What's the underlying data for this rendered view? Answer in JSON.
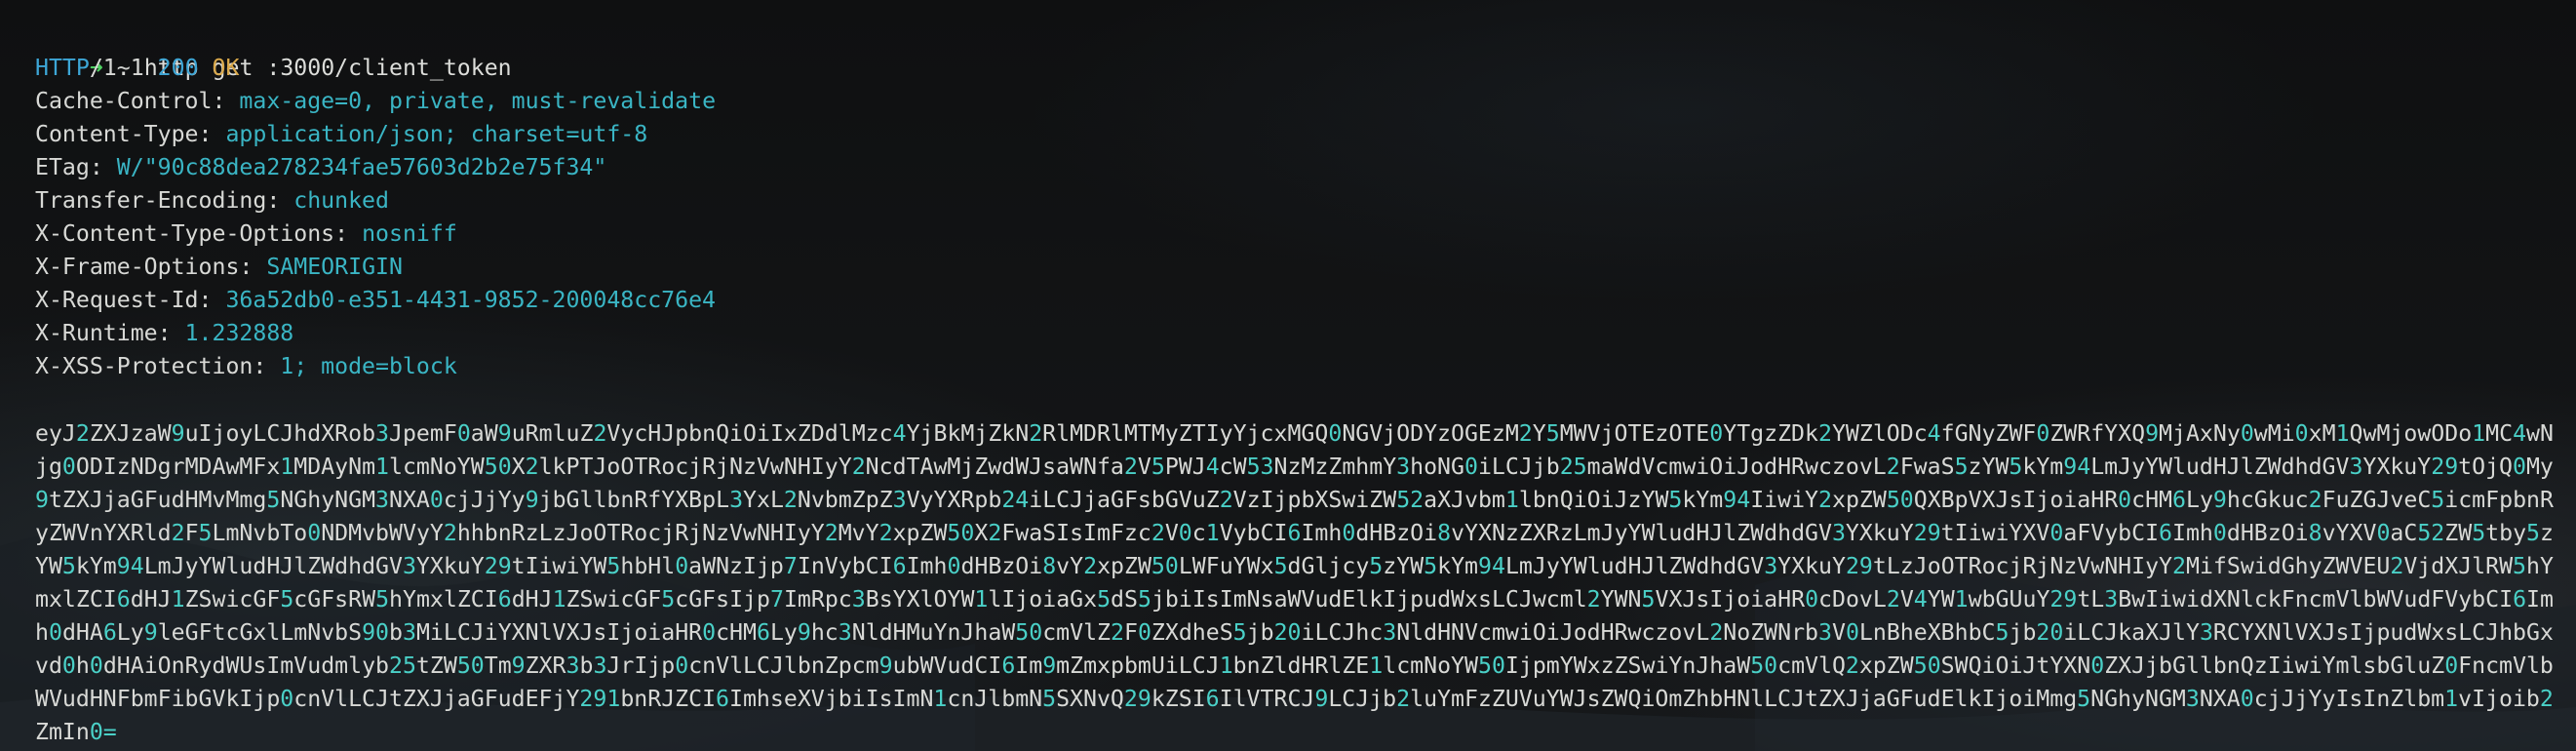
{
  "prompt": {
    "arrow": "➜",
    "cwd": "~",
    "command": "http get :3000/client_token"
  },
  "status": {
    "protocol": "HTTP",
    "version": "/1.1",
    "code": "200",
    "text": "OK"
  },
  "headers": [
    {
      "name": "Cache-Control:",
      "value": "max-age=0, private, must-revalidate"
    },
    {
      "name": "Content-Type:",
      "value": "application/json; charset=utf-8"
    },
    {
      "name": "ETag:",
      "value": "W/\"90c88dea278234fae57603d2b2e75f34\""
    },
    {
      "name": "Transfer-Encoding:",
      "value": "chunked"
    },
    {
      "name": "X-Content-Type-Options:",
      "value": "nosniff"
    },
    {
      "name": "X-Frame-Options:",
      "value": "SAMEORIGIN"
    },
    {
      "name": "X-Request-Id:",
      "value": "36a52db0-e351-4431-9852-200048cc76e4"
    },
    {
      "name": "X-Runtime:",
      "value": "1.232888"
    },
    {
      "name": "X-XSS-Protection:",
      "value": "1; mode=block"
    }
  ],
  "body": "eyJ2ZXJzaW9uIjoyLCJhdXRob3JpemF0aW9uRmluZ2VycHJpbnQiOiIxZDdlMzc4YjBkMjZkN2RlMDRlMTMyZTIyYjcxMGQ0NGVjODYzOGEzM2Y5MWVjOTEzOTE0YTgzZDk2YWZlODc4fGNyZWF0ZWRfYXQ9MjAxNy0wMi0xM1QwMjowODo1MC4wNjg0ODIzNDgrMDAwMFx1MDAyNm1lcmNoYW50X2lkPTJoOTRocjRjNzVwNHIyY2NcdTAwMjZwdWJsaWNfa2V5PWJ4cW53NzMzZmhmY3hoNG0iLCJjb25maWdVcmwiOiJodHRwczovL2FwaS5zYW5kYm94LmJyYWludHJlZWdhdGV3YXkuY29tOjQ0My9tZXJjaGFudHMvMmg5NGhyNGM3NXA0cjJjYy9jbGllbnRfYXBpL3YxL2NvbmZpZ3VyYXRpb24iLCJjaGFsbGVuZ2VzIjpbXSwiZW52aXJvbm1lbnQiOiJzYW5kYm94IiwiY2xpZW50QXBpVXJsIjoiaHR0cHM6Ly9hcGkuc2FuZGJveC5icmFpbnRyZWVnYXRld2F5LmNvbTo0NDMvbWVyY2hhbnRzLzJoOTRocjRjNzVwNHIyY2MvY2xpZW50X2FwaSIsImFzc2V0c1VybCI6Imh0dHBzOi8vYXNzZXRzLmJyYWludHJlZWdhdGV3YXkuY29tIiwiYXV0aFVybCI6Imh0dHBzOi8vYXV0aC52ZW5tby5zYW5kYm94LmJyYWludHJlZWdhdGV3YXkuY29tIiwiYW5hbHl0aWNzIjp7InVybCI6Imh0dHBzOi8vY2xpZW50LWFuYWx5dGljcy5zYW5kYm94LmJyYWludHJlZWdhdGV3YXkuY29tLzJoOTRocjRjNzVwNHIyY2MifSwidGhyZWVEU2VjdXJlRW5hYmxlZCI6dHJ1ZSwicGF5cGFsRW5hYmxlZCI6dHJ1ZSwicGF5cGFsIjp7ImRpc3BsYXlOYW1lIjoiaGx5dS5jbiIsImNsaWVudElkIjpudWxsLCJwcml2YWN5VXJsIjoiaHR0cDovL2V4YW1wbGUuY29tL3BwIiwidXNlckFncmVlbWVudFVybCI6Imh0dHA6Ly9leGFtcGxlLmNvbS90b3MiLCJiYXNlVXJsIjoiaHR0cHM6Ly9hc3NldHMuYnJhaW50cmVlZ2F0ZXdheS5jb20iLCJhc3NldHNVcmwiOiJodHRwczovL2NoZWNrb3V0LnBheXBhbC5jb20iLCJkaXJlY3RCYXNlVXJsIjpudWxsLCJhbGxvd0h0dHAiOnRydWUsImVudmlyb25tZW50Tm9ZXR3b3JrIjp0cnVlLCJlbnZpcm9ubWVudCI6Im9mZmxpbmUiLCJ1bnZldHRlZE1lcmNoYW50IjpmYWxzZSwiYnJhaW50cmVlQ2xpZW50SWQiOiJtYXN0ZXJjbGllbnQzIiwiYmlsbGluZ0FncmVlbWVudHNFbmFibGVkIjp0cnVlLCJtZXJjaGFudEFjY291bnRJZCI6ImhseXVjbiIsImN1cnJlbmN5SXNvQ29kZSI6IlVTRCJ9LCJjb2luYmFzZUVuYWJsZWQiOmZhbHNlLCJtZXJjaGFudElkIjoiMmg5NGhyNGM3NXA0cjJjYyIsInZlbm1vIjoib2ZmIn0="
}
